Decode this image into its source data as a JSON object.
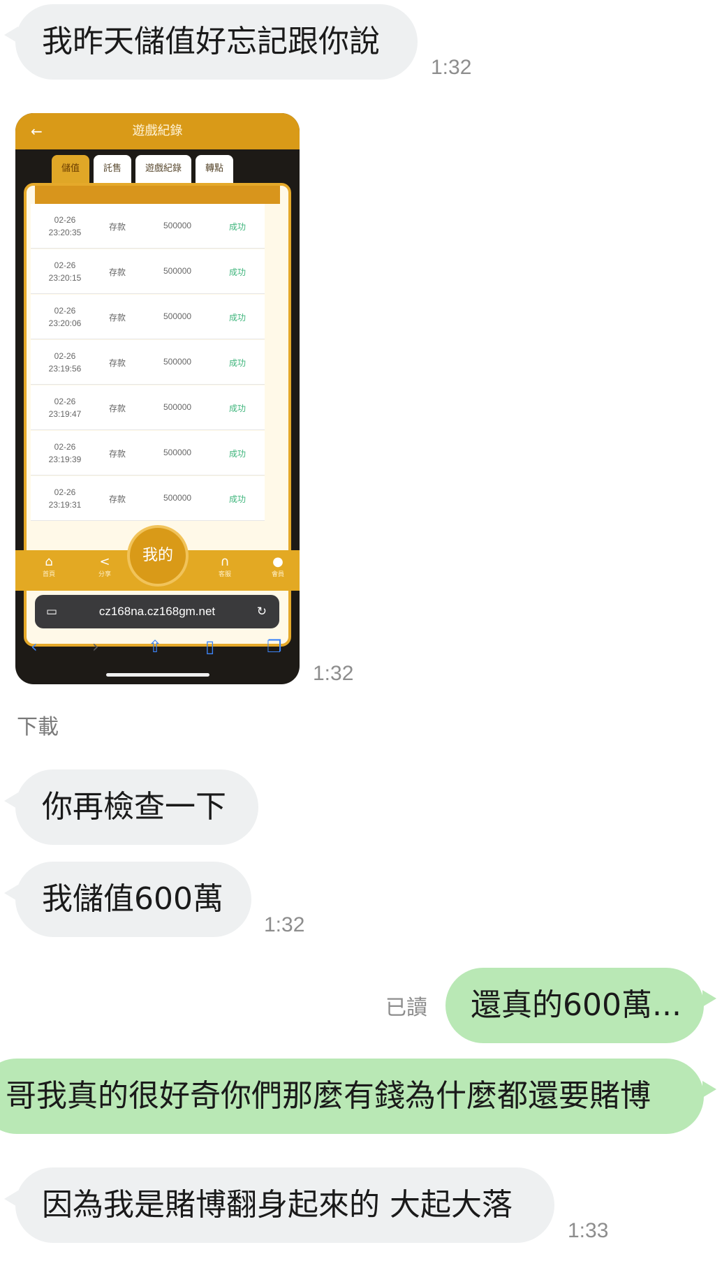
{
  "messages": {
    "m1": {
      "text": "我昨天儲值好忘記跟你說",
      "time": "1:32"
    },
    "image": {
      "time": "1:32",
      "download_label": "下載"
    },
    "m2": {
      "text": "你再檢查一下"
    },
    "m3": {
      "text": "我儲值600萬",
      "time": "1:32"
    },
    "m4": {
      "text": "還真的600萬...",
      "read_label": "已讀"
    },
    "m5": {
      "text": "哥我真的很好奇你們那麼有錢為什麼都還要賭博"
    },
    "m6": {
      "text": "因為我是賭博翻身起來的 大起大落",
      "time": "1:33"
    }
  },
  "screenshot": {
    "header_title": "遊戲紀錄",
    "back_icon": "←",
    "tabs": [
      "儲值",
      "託售",
      "遊戲紀錄",
      "轉點"
    ],
    "rows": [
      {
        "date": "02-26",
        "time": "23:20:35",
        "type": "存款",
        "amount": "500000",
        "status": "成功"
      },
      {
        "date": "02-26",
        "time": "23:20:15",
        "type": "存款",
        "amount": "500000",
        "status": "成功"
      },
      {
        "date": "02-26",
        "time": "23:20:06",
        "type": "存款",
        "amount": "500000",
        "status": "成功"
      },
      {
        "date": "02-26",
        "time": "23:19:56",
        "type": "存款",
        "amount": "500000",
        "status": "成功"
      },
      {
        "date": "02-26",
        "time": "23:19:47",
        "type": "存款",
        "amount": "500000",
        "status": "成功"
      },
      {
        "date": "02-26",
        "time": "23:19:39",
        "type": "存款",
        "amount": "500000",
        "status": "成功"
      },
      {
        "date": "02-26",
        "time": "23:19:31",
        "type": "存款",
        "amount": "500000",
        "status": "成功"
      }
    ],
    "nav": {
      "home": "首頁",
      "share": "分享",
      "center": "我的",
      "service": "客服",
      "user": "會員"
    },
    "url": "cz168na.cz168gm.net",
    "icons": {
      "home": "⌂",
      "share": "<",
      "headset": "∩",
      "user": "●",
      "tabs": "▭",
      "reload": "↻",
      "lock": "🔒",
      "back": "‹",
      "forward": "›",
      "upload": "⇧",
      "book": "▯",
      "copy": "❐"
    }
  }
}
